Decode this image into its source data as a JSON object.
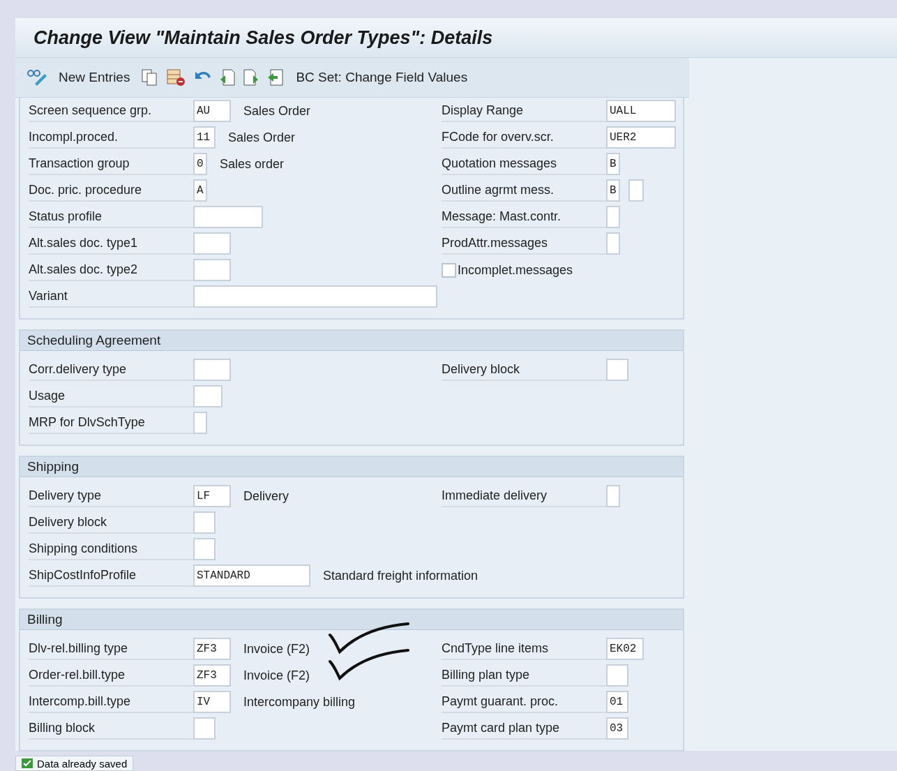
{
  "window": {
    "title": "Change View \"Maintain Sales Order Types\": Details"
  },
  "toolbar": {
    "buttons": [
      {
        "kind": "glasses"
      },
      {
        "kind": "text",
        "label": "New Entries"
      },
      {
        "kind": "copy"
      },
      {
        "kind": "delete"
      },
      {
        "kind": "undo"
      },
      {
        "kind": "prev"
      },
      {
        "kind": "next"
      },
      {
        "kind": "export"
      },
      {
        "kind": "text",
        "label": "BC Set: Change Field Values"
      }
    ]
  },
  "sections": [
    {
      "rows": [
        {
          "left": {
            "label": "Screen sequence grp.",
            "value": "AU",
            "description": "Sales Order"
          },
          "right": {
            "kind": "field",
            "label": "Display Range",
            "value": "UALL"
          }
        },
        {
          "left": {
            "label": "Incompl.proced.",
            "value": "11",
            "description": "Sales Order"
          },
          "right": {
            "kind": "field",
            "label": "FCode for overv.scr.",
            "value": "UER2"
          }
        },
        {
          "left": {
            "label": "Transaction group",
            "value": "0",
            "description": "Sales order"
          },
          "right": {
            "kind": "field",
            "label": "Quotation messages",
            "value": "B"
          }
        },
        {
          "left": {
            "label": "Doc. pric. procedure",
            "value": "A"
          },
          "right": {
            "kind": "field",
            "label": "Outline agrmt mess.",
            "value": "B",
            "extra_field": true
          }
        },
        {
          "left": {
            "label": "Status profile"
          },
          "right": {
            "kind": "field",
            "label": "Message: Mast.contr."
          }
        },
        {
          "left": {
            "label": "Alt.sales doc. type1"
          },
          "right": {
            "kind": "field",
            "label": "ProdAttr.messages"
          }
        },
        {
          "left": {
            "label": "Alt.sales doc. type2"
          },
          "right": {
            "kind": "checkbox",
            "label": "Incomplet.messages",
            "checked": false
          }
        },
        {
          "left": {
            "label": "Variant"
          }
        }
      ]
    },
    {
      "title": "Scheduling Agreement",
      "rows": [
        {
          "left": {
            "label": "Corr.delivery type"
          },
          "right": {
            "kind": "field",
            "label": "Delivery block"
          }
        },
        {
          "left": {
            "label": "Usage"
          }
        },
        {
          "left": {
            "label": "MRP for DlvSchType"
          }
        }
      ]
    },
    {
      "title": "Shipping",
      "rows": [
        {
          "left": {
            "label": "Delivery type",
            "value": "LF",
            "description": "Delivery"
          },
          "right": {
            "kind": "field",
            "label": "Immediate delivery"
          }
        },
        {
          "left": {
            "label": "Delivery block"
          }
        },
        {
          "left": {
            "label": "Shipping conditions"
          }
        },
        {
          "left": {
            "label": "ShipCostInfoProfile",
            "value": "STANDARD",
            "description": "Standard freight information"
          }
        }
      ]
    },
    {
      "title": "Billing",
      "rows": [
        {
          "left": {
            "label": "Dlv-rel.billing type",
            "value": "ZF3",
            "description": "Invoice (F2)",
            "ticked": true
          },
          "right": {
            "kind": "field",
            "label": "CndType line items",
            "value": "EK02"
          }
        },
        {
          "left": {
            "label": "Order-rel.bill.type",
            "value": "ZF3",
            "description": "Invoice (F2)",
            "ticked": true
          },
          "right": {
            "kind": "field",
            "label": "Billing plan type"
          }
        },
        {
          "left": {
            "label": "Intercomp.bill.type",
            "value": "IV",
            "description": "Intercompany billing"
          },
          "right": {
            "kind": "field",
            "label": "Paymt guarant. proc.",
            "value": "01"
          }
        },
        {
          "left": {
            "label": "Billing block"
          },
          "right": {
            "kind": "field",
            "label": "Paymt card plan type",
            "value": "03"
          }
        }
      ]
    }
  ],
  "status_bar": {
    "message": "Data already saved"
  }
}
